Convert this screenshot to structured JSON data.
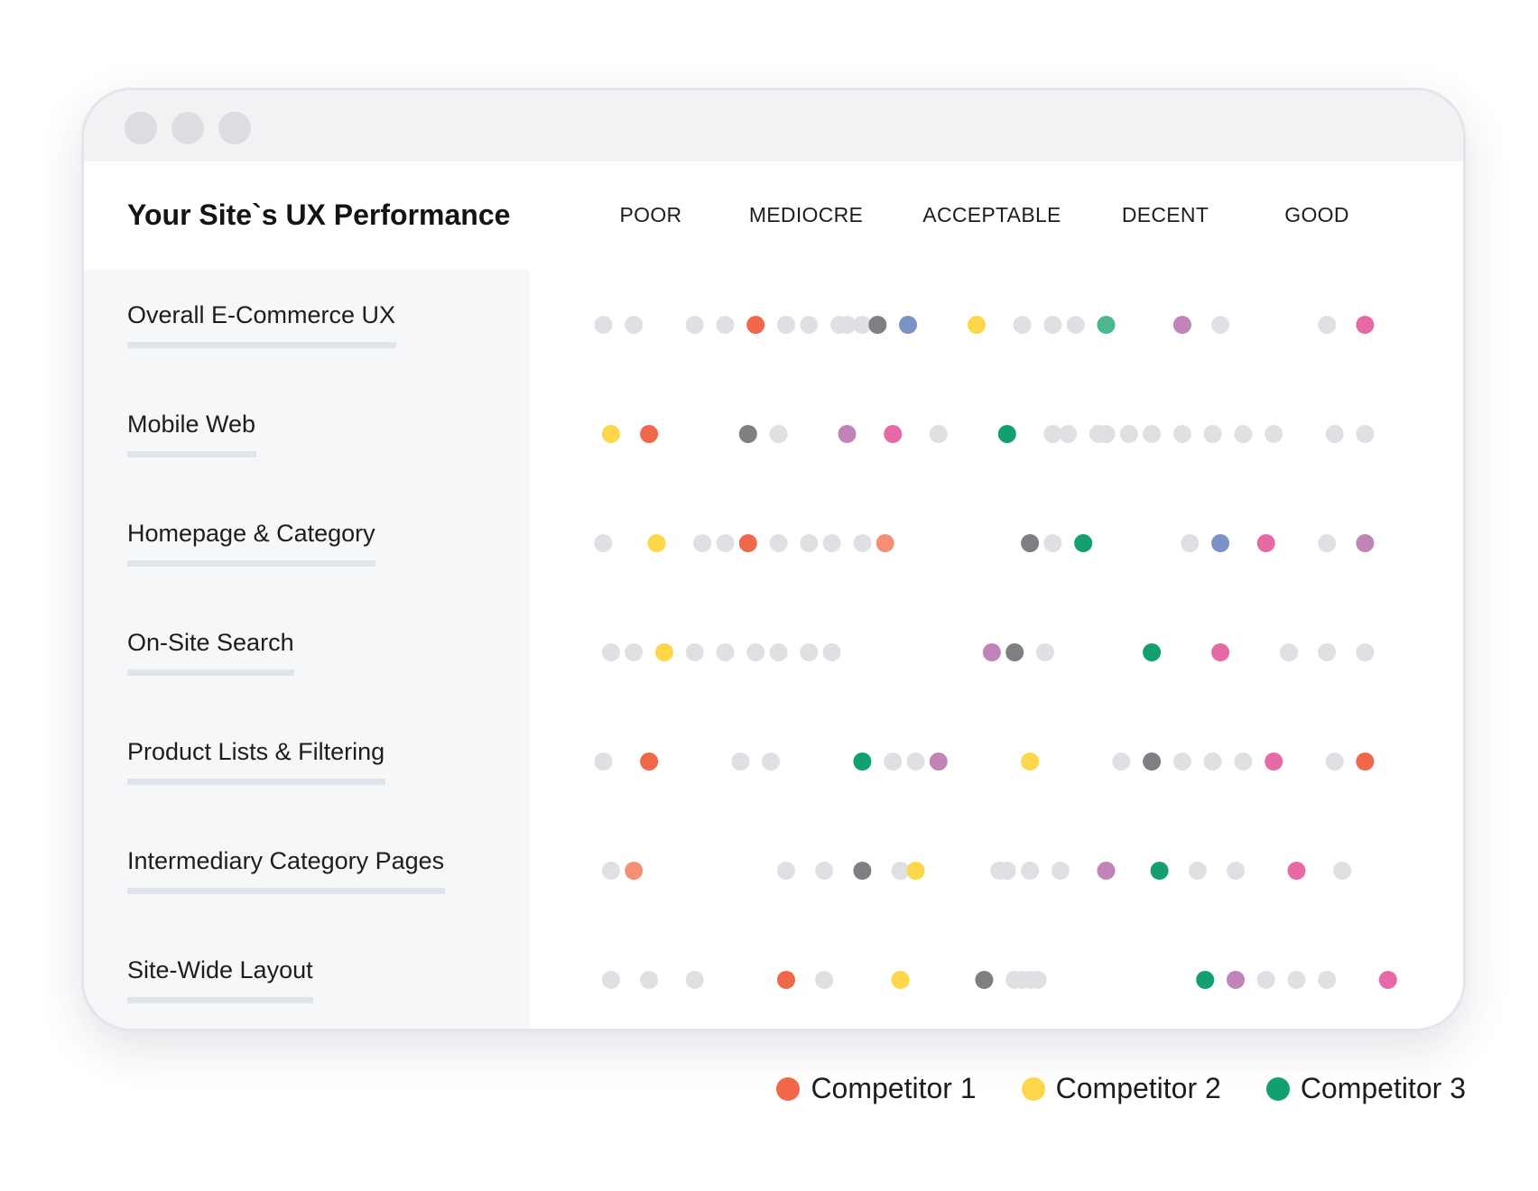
{
  "chart_data": {
    "type": "scatter",
    "title": "Your Site`s UX Performance",
    "levels": [
      "POOR",
      "MEDIOCRE",
      "ACCEPTABLE",
      "DECENT",
      "GOOD"
    ],
    "x_range": [
      0,
      100
    ],
    "rows": [
      {
        "label": "Overall E-Commerce UX",
        "points": [
          {
            "x": 1,
            "c": "other"
          },
          {
            "x": 5,
            "c": "other"
          },
          {
            "x": 13,
            "c": "other"
          },
          {
            "x": 17,
            "c": "other"
          },
          {
            "x": 21,
            "c": "c1"
          },
          {
            "x": 25,
            "c": "other"
          },
          {
            "x": 28,
            "c": "other"
          },
          {
            "x": 32,
            "c": "other"
          },
          {
            "x": 33,
            "c": "other"
          },
          {
            "x": 35,
            "c": "other"
          },
          {
            "x": 37,
            "c": "gray"
          },
          {
            "x": 41,
            "c": "blue"
          },
          {
            "x": 50,
            "c": "c2"
          },
          {
            "x": 56,
            "c": "other"
          },
          {
            "x": 60,
            "c": "other"
          },
          {
            "x": 63,
            "c": "other"
          },
          {
            "x": 67,
            "c": "c3light"
          },
          {
            "x": 77,
            "c": "purple"
          },
          {
            "x": 82,
            "c": "other"
          },
          {
            "x": 96,
            "c": "other"
          },
          {
            "x": 101,
            "c": "pink"
          }
        ]
      },
      {
        "label": "Mobile Web",
        "points": [
          {
            "x": 2,
            "c": "c2"
          },
          {
            "x": 7,
            "c": "c1"
          },
          {
            "x": 20,
            "c": "gray"
          },
          {
            "x": 24,
            "c": "other"
          },
          {
            "x": 33,
            "c": "purple"
          },
          {
            "x": 39,
            "c": "pink"
          },
          {
            "x": 45,
            "c": "other"
          },
          {
            "x": 54,
            "c": "c3"
          },
          {
            "x": 60,
            "c": "other"
          },
          {
            "x": 62,
            "c": "other"
          },
          {
            "x": 66,
            "c": "other"
          },
          {
            "x": 67,
            "c": "other"
          },
          {
            "x": 70,
            "c": "other"
          },
          {
            "x": 73,
            "c": "other"
          },
          {
            "x": 77,
            "c": "other"
          },
          {
            "x": 81,
            "c": "other"
          },
          {
            "x": 85,
            "c": "other"
          },
          {
            "x": 89,
            "c": "other"
          },
          {
            "x": 97,
            "c": "other"
          },
          {
            "x": 101,
            "c": "other"
          }
        ]
      },
      {
        "label": "Homepage & Category",
        "points": [
          {
            "x": 1,
            "c": "other"
          },
          {
            "x": 8,
            "c": "c2"
          },
          {
            "x": 14,
            "c": "other"
          },
          {
            "x": 17,
            "c": "other"
          },
          {
            "x": 20,
            "c": "c1"
          },
          {
            "x": 24,
            "c": "other"
          },
          {
            "x": 28,
            "c": "other"
          },
          {
            "x": 31,
            "c": "other"
          },
          {
            "x": 35,
            "c": "other"
          },
          {
            "x": 38,
            "c": "salmon"
          },
          {
            "x": 57,
            "c": "gray"
          },
          {
            "x": 60,
            "c": "other"
          },
          {
            "x": 64,
            "c": "c3"
          },
          {
            "x": 78,
            "c": "other"
          },
          {
            "x": 82,
            "c": "blue"
          },
          {
            "x": 88,
            "c": "pink"
          },
          {
            "x": 96,
            "c": "other"
          },
          {
            "x": 101,
            "c": "purple"
          }
        ]
      },
      {
        "label": "On-Site Search",
        "points": [
          {
            "x": 2,
            "c": "other"
          },
          {
            "x": 5,
            "c": "other"
          },
          {
            "x": 9,
            "c": "c2"
          },
          {
            "x": 13,
            "c": "other"
          },
          {
            "x": 17,
            "c": "other"
          },
          {
            "x": 21,
            "c": "other"
          },
          {
            "x": 24,
            "c": "other"
          },
          {
            "x": 28,
            "c": "other"
          },
          {
            "x": 31,
            "c": "other"
          },
          {
            "x": 52,
            "c": "purple"
          },
          {
            "x": 55,
            "c": "gray"
          },
          {
            "x": 59,
            "c": "other"
          },
          {
            "x": 73,
            "c": "c3"
          },
          {
            "x": 82,
            "c": "pink"
          },
          {
            "x": 91,
            "c": "other"
          },
          {
            "x": 96,
            "c": "other"
          },
          {
            "x": 101,
            "c": "other"
          }
        ]
      },
      {
        "label": "Product Lists & Filtering",
        "points": [
          {
            "x": 1,
            "c": "other"
          },
          {
            "x": 7,
            "c": "c1"
          },
          {
            "x": 19,
            "c": "other"
          },
          {
            "x": 23,
            "c": "other"
          },
          {
            "x": 35,
            "c": "c3"
          },
          {
            "x": 39,
            "c": "other"
          },
          {
            "x": 42,
            "c": "other"
          },
          {
            "x": 45,
            "c": "purple"
          },
          {
            "x": 57,
            "c": "c2"
          },
          {
            "x": 69,
            "c": "other"
          },
          {
            "x": 73,
            "c": "gray"
          },
          {
            "x": 77,
            "c": "other"
          },
          {
            "x": 81,
            "c": "other"
          },
          {
            "x": 85,
            "c": "other"
          },
          {
            "x": 89,
            "c": "pink"
          },
          {
            "x": 97,
            "c": "other"
          },
          {
            "x": 101,
            "c": "c1"
          }
        ]
      },
      {
        "label": "Intermediary Category Pages",
        "points": [
          {
            "x": 2,
            "c": "other"
          },
          {
            "x": 5,
            "c": "salmon"
          },
          {
            "x": 25,
            "c": "other"
          },
          {
            "x": 30,
            "c": "other"
          },
          {
            "x": 35,
            "c": "gray"
          },
          {
            "x": 40,
            "c": "other"
          },
          {
            "x": 42,
            "c": "c2"
          },
          {
            "x": 53,
            "c": "other"
          },
          {
            "x": 54,
            "c": "other"
          },
          {
            "x": 57,
            "c": "other"
          },
          {
            "x": 61,
            "c": "other"
          },
          {
            "x": 67,
            "c": "purple"
          },
          {
            "x": 74,
            "c": "c3"
          },
          {
            "x": 79,
            "c": "other"
          },
          {
            "x": 84,
            "c": "other"
          },
          {
            "x": 92,
            "c": "pink"
          },
          {
            "x": 98,
            "c": "other"
          }
        ]
      },
      {
        "label": "Site-Wide Layout",
        "points": [
          {
            "x": 2,
            "c": "other"
          },
          {
            "x": 7,
            "c": "other"
          },
          {
            "x": 13,
            "c": "other"
          },
          {
            "x": 25,
            "c": "c1"
          },
          {
            "x": 30,
            "c": "other"
          },
          {
            "x": 40,
            "c": "c2"
          },
          {
            "x": 51,
            "c": "gray"
          },
          {
            "x": 55,
            "c": "other"
          },
          {
            "x": 56,
            "c": "other"
          },
          {
            "x": 57,
            "c": "other"
          },
          {
            "x": 58,
            "c": "other"
          },
          {
            "x": 80,
            "c": "c3"
          },
          {
            "x": 84,
            "c": "purple"
          },
          {
            "x": 88,
            "c": "other"
          },
          {
            "x": 92,
            "c": "other"
          },
          {
            "x": 96,
            "c": "other"
          },
          {
            "x": 104,
            "c": "pink"
          }
        ]
      }
    ],
    "legend": [
      {
        "key": "c1",
        "label": "Competitor 1"
      },
      {
        "key": "c2",
        "label": "Competitor 2"
      },
      {
        "key": "c3",
        "label": "Competitor 3"
      }
    ],
    "legend_position": "bottom-right",
    "grid": false,
    "colors": {
      "other": "#dfe0e4",
      "c1": "#f0674a",
      "c2": "#fdd64a",
      "c3": "#13a06f",
      "c3light": "#4cb890",
      "gray": "#7f7f83",
      "blue": "#7b92c4",
      "purple": "#c184b9",
      "pink": "#e56aa6",
      "salmon": "#f48f76"
    }
  }
}
